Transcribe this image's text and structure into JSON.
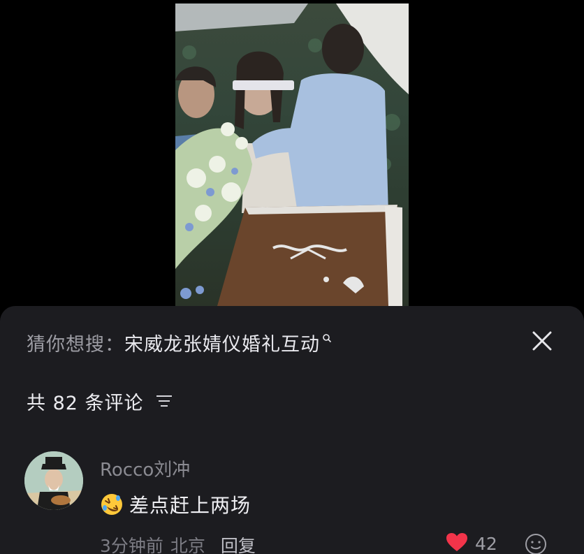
{
  "video": {
    "content_note": ""
  },
  "suggest": {
    "prefix": "猜你想搜：",
    "query": "宋威龙张婧仪婚礼互动",
    "search_icon": "search-icon",
    "close_icon": "close-icon"
  },
  "comments_header": {
    "count_text": "共 82 条评论",
    "sort_icon": "sort-icon"
  },
  "comment": {
    "username": "Rocco刘冲",
    "emoji": "rolling-laughing-emoji",
    "text": "差点赶上两场",
    "time": "3分钟前",
    "location": "北京",
    "reply_label": "回复",
    "likes": "42",
    "like_icon": "heart-icon",
    "react_icon": "emoji-face-icon"
  },
  "colors": {
    "panel_bg": "#1c1c20",
    "heart": "#f2344a",
    "primary_text": "#f0f0f4",
    "secondary_text": "#8b8b92"
  }
}
